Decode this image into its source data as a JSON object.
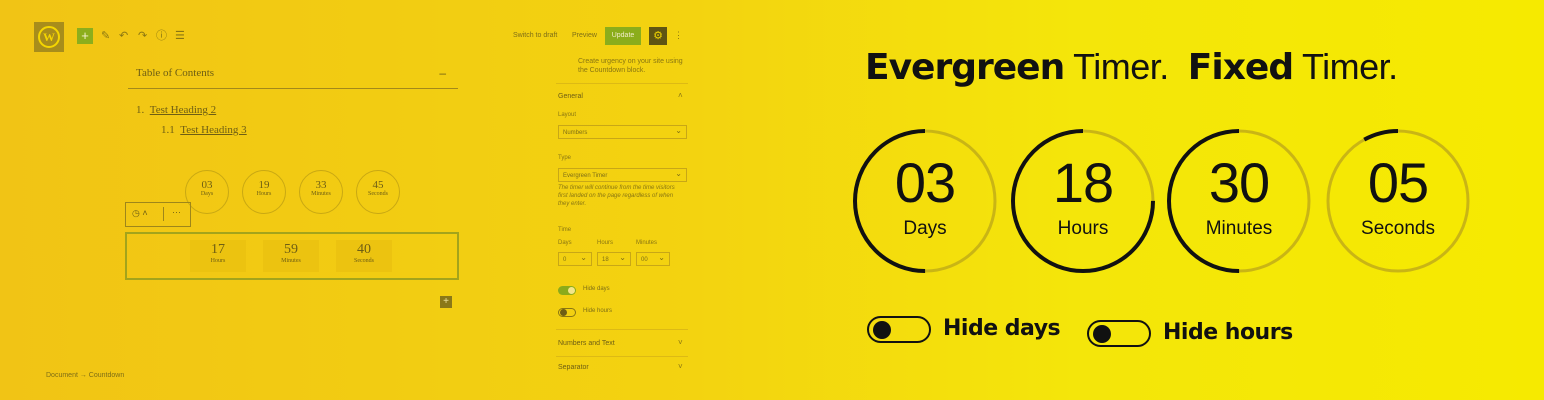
{
  "editor": {
    "toolbar": {
      "logo": "W",
      "add_icon": "+",
      "switch_to_draft": "Switch to draft",
      "preview": "Preview",
      "update": "Update",
      "settings_icon": "⚙",
      "more_icon": "⋮"
    },
    "toc": {
      "title": "Table of Contents",
      "collapse": "–",
      "items": [
        {
          "number": "1.",
          "text": "Test Heading 2"
        },
        {
          "number": "1.1",
          "text": "Test Heading 3"
        }
      ]
    },
    "countdown_preview": [
      {
        "value": "03",
        "label": "Days"
      },
      {
        "value": "19",
        "label": "Hours"
      },
      {
        "value": "33",
        "label": "Minutes"
      },
      {
        "value": "45",
        "label": "Seconds"
      }
    ],
    "fixed_preview": [
      {
        "value": "17",
        "label": "Hours"
      },
      {
        "value": "59",
        "label": "Minutes"
      },
      {
        "value": "40",
        "label": "Seconds"
      }
    ],
    "block_toolbar_more": "···",
    "add_block": "+",
    "breadcrumb": "Document → Countdown"
  },
  "sidebar": {
    "description": "Create urgency on your site using the Countdown block.",
    "general": "General",
    "layout_label": "Layout",
    "layout_value": "Numbers",
    "type_label": "Type",
    "type_value": "Evergreen Timer",
    "type_help": "The timer will continue from the time visitors first landed on the page regardless of when they enter.",
    "time_label": "Time",
    "days_label": "Days",
    "hours_label": "Hours",
    "minutes_label": "Minutes",
    "days_value": "0",
    "hours_value": "18",
    "minutes_value": "00",
    "hide_days": "Hide days",
    "hide_hours": "Hide hours",
    "numbers_and_text": "Numbers and Text",
    "separator": "Separator"
  },
  "marketing": {
    "evergreen_bold": "Evergreen",
    "evergreen_light": " Timer.",
    "fixed_bold": "Fixed",
    "fixed_light": " Timer.",
    "timer": [
      {
        "value": "03",
        "label": "Days",
        "progress": 0.5
      },
      {
        "value": "18",
        "label": "Hours",
        "progress": 0.75
      },
      {
        "value": "30",
        "label": "Minutes",
        "progress": 0.5
      },
      {
        "value": "05",
        "label": "Seconds",
        "progress": 0.08
      }
    ],
    "toggle_hide_days": "Hide days",
    "toggle_hide_hours": "Hide hours"
  },
  "colors": {
    "background_start": "#f1c415",
    "background_end": "#f6ea00",
    "ring_track": "#c9b515",
    "ring_progress": "#111111",
    "accent_green": "#8bad1b"
  }
}
